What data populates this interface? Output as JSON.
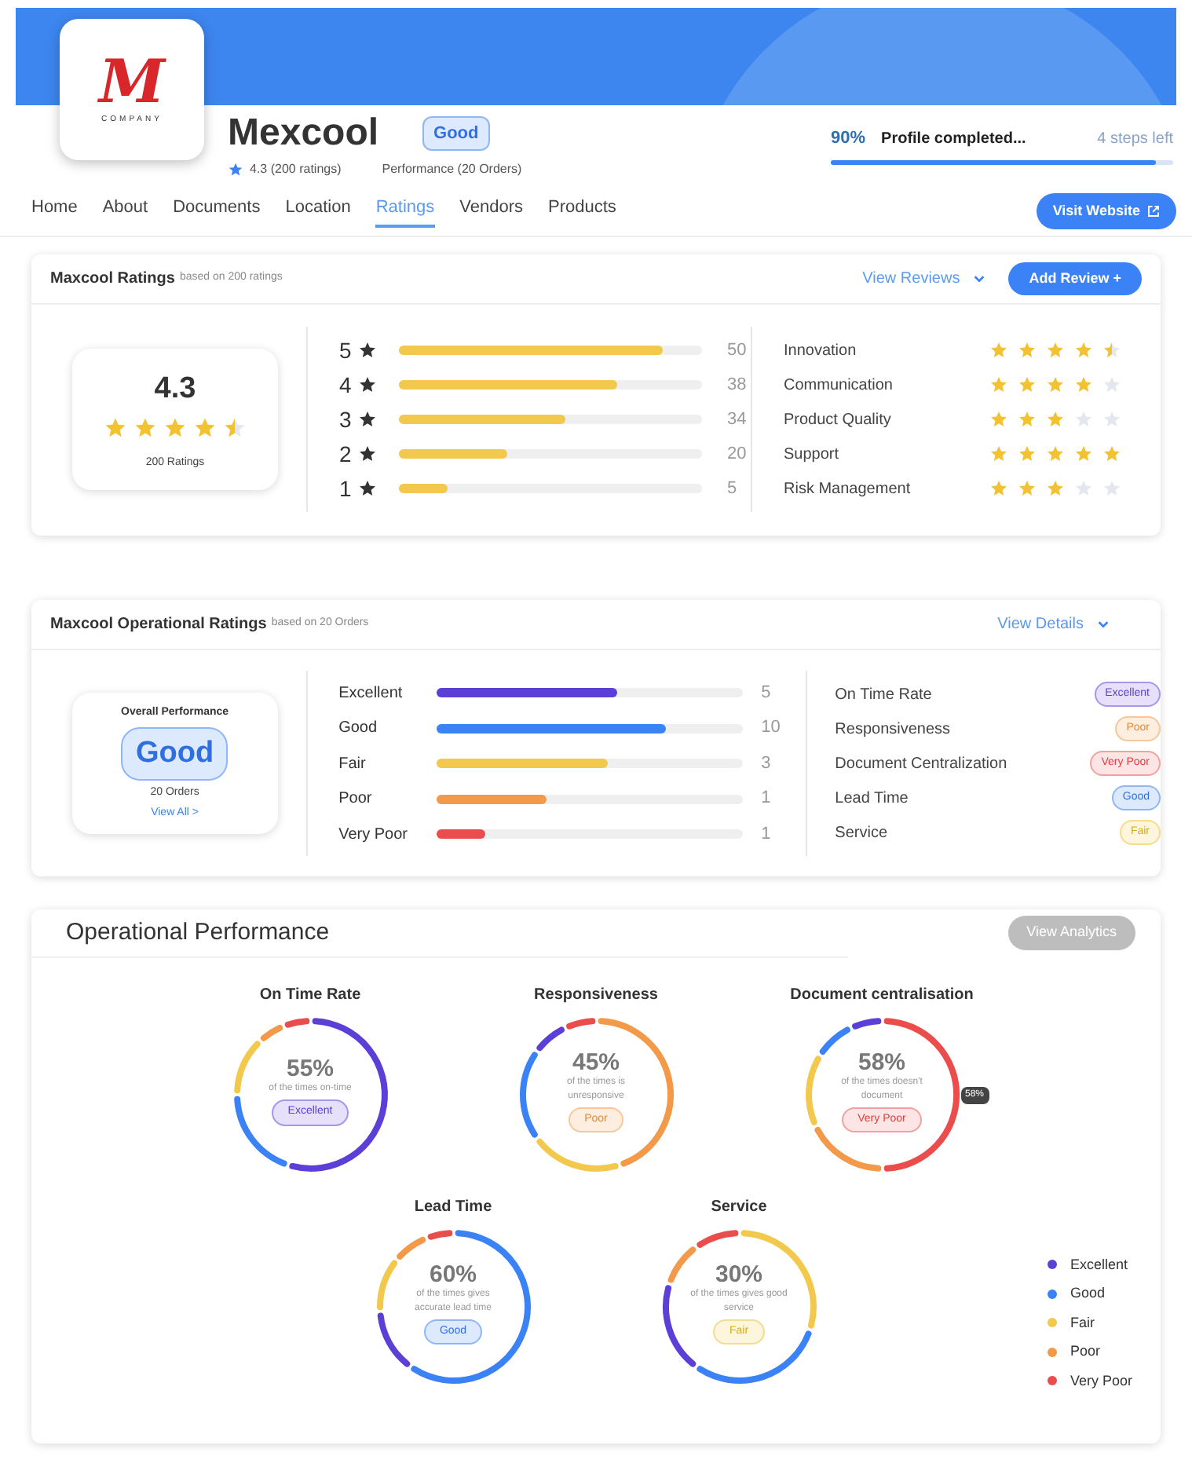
{
  "header": {
    "logo_letter": "M",
    "logo_caption": "COMPANY",
    "company_name": "Mexcool",
    "status_badge": "Good",
    "rating_summary": "4.3 (200 ratings)",
    "performance_summary": "Performance (20 Orders)",
    "profile": {
      "percent": "90%",
      "label": "Profile completed...",
      "steps_left": "4 steps left",
      "level": 0.95
    }
  },
  "tabs": [
    {
      "label": "Home",
      "selected": false
    },
    {
      "label": "About",
      "selected": false
    },
    {
      "label": "Documents",
      "selected": false
    },
    {
      "label": "Location",
      "selected": false
    },
    {
      "label": "Ratings",
      "selected": true
    },
    {
      "label": "Vendors",
      "selected": false
    },
    {
      "label": "Products",
      "selected": false
    }
  ],
  "visit_button": "Visit Website",
  "ratings_card": {
    "title": "Maxcool Ratings",
    "subtitle": "based on 200 ratings",
    "view_link": "View Reviews",
    "add_button": "Add Review +",
    "score": "4.3",
    "stars": 4.5,
    "count_label": "200 Ratings",
    "distribution": [
      {
        "label": "5",
        "level": 0.87,
        "count": "50"
      },
      {
        "label": "4",
        "level": 0.72,
        "count": "38"
      },
      {
        "label": "3",
        "level": 0.55,
        "count": "34"
      },
      {
        "label": "2",
        "level": 0.36,
        "count": "20"
      },
      {
        "label": "1",
        "level": 0.16,
        "count": "5"
      }
    ],
    "criteria": [
      {
        "name": "Innovation",
        "stars": 4.5
      },
      {
        "name": "Communication",
        "stars": 4
      },
      {
        "name": "Product Quality",
        "stars": 3
      },
      {
        "name": "Support",
        "stars": 5
      },
      {
        "name": "Risk Management",
        "stars": 3
      }
    ]
  },
  "operational_card": {
    "title": "Maxcool Operational Ratings",
    "subtitle": "based on 20 Orders",
    "view_link": "View Details",
    "overall_label": "Overall Performance",
    "overall_value": "Good",
    "orders": "20 Orders",
    "view_all": "View All >",
    "distribution": [
      {
        "label": "Excellent",
        "color": "#5b3fd6",
        "level": 0.59,
        "count": "5"
      },
      {
        "label": "Good",
        "color": "#3b82f6",
        "level": 0.75,
        "count": "10"
      },
      {
        "label": "Fair",
        "color": "#f2c94c",
        "level": 0.56,
        "count": "3"
      },
      {
        "label": "Poor",
        "color": "#f2994a",
        "level": 0.36,
        "count": "1"
      },
      {
        "label": "Very Poor",
        "color": "#eb4d4d",
        "level": 0.16,
        "count": "1"
      }
    ],
    "metrics": [
      {
        "name": "On Time Rate",
        "badge": "Excellent",
        "kind": "excellent"
      },
      {
        "name": "Responsiveness",
        "badge": "Poor",
        "kind": "poor"
      },
      {
        "name": "Document Centralization",
        "badge": "Very Poor",
        "kind": "verypoor"
      },
      {
        "name": "Lead Time",
        "badge": "Good",
        "kind": "good"
      },
      {
        "name": "Service",
        "badge": "Fair",
        "kind": "fair"
      }
    ]
  },
  "performance_card": {
    "title": "Operational Performance",
    "analytics_button": "View Analytics",
    "rings": [
      {
        "title": "On Time Rate",
        "percent": "55%",
        "caption": "of the times on-time",
        "badge": "Excellent",
        "kind": "excellent"
      },
      {
        "title": "Responsiveness",
        "percent": "45%",
        "caption": "of the times is unresponsive",
        "badge": "Poor",
        "kind": "poor"
      },
      {
        "title": "Document centralisation",
        "percent": "58%",
        "caption": "of the times doesn't document",
        "badge": "Very Poor",
        "kind": "verypoor",
        "tooltip": "58%"
      },
      {
        "title": "Lead Time",
        "percent": "60%",
        "caption": "of the times gives accurate lead time",
        "badge": "Good",
        "kind": "good"
      },
      {
        "title": "Service",
        "percent": "30%",
        "caption": "of the times gives good service",
        "badge": "Fair",
        "kind": "fair"
      }
    ],
    "legend": [
      {
        "label": "Excellent",
        "color": "#5b3fd6"
      },
      {
        "label": "Good",
        "color": "#3b82f6"
      },
      {
        "label": "Fair",
        "color": "#f2c94c"
      },
      {
        "label": "Poor",
        "color": "#f2994a"
      },
      {
        "label": "Very Poor",
        "color": "#eb4d4d"
      }
    ]
  }
}
